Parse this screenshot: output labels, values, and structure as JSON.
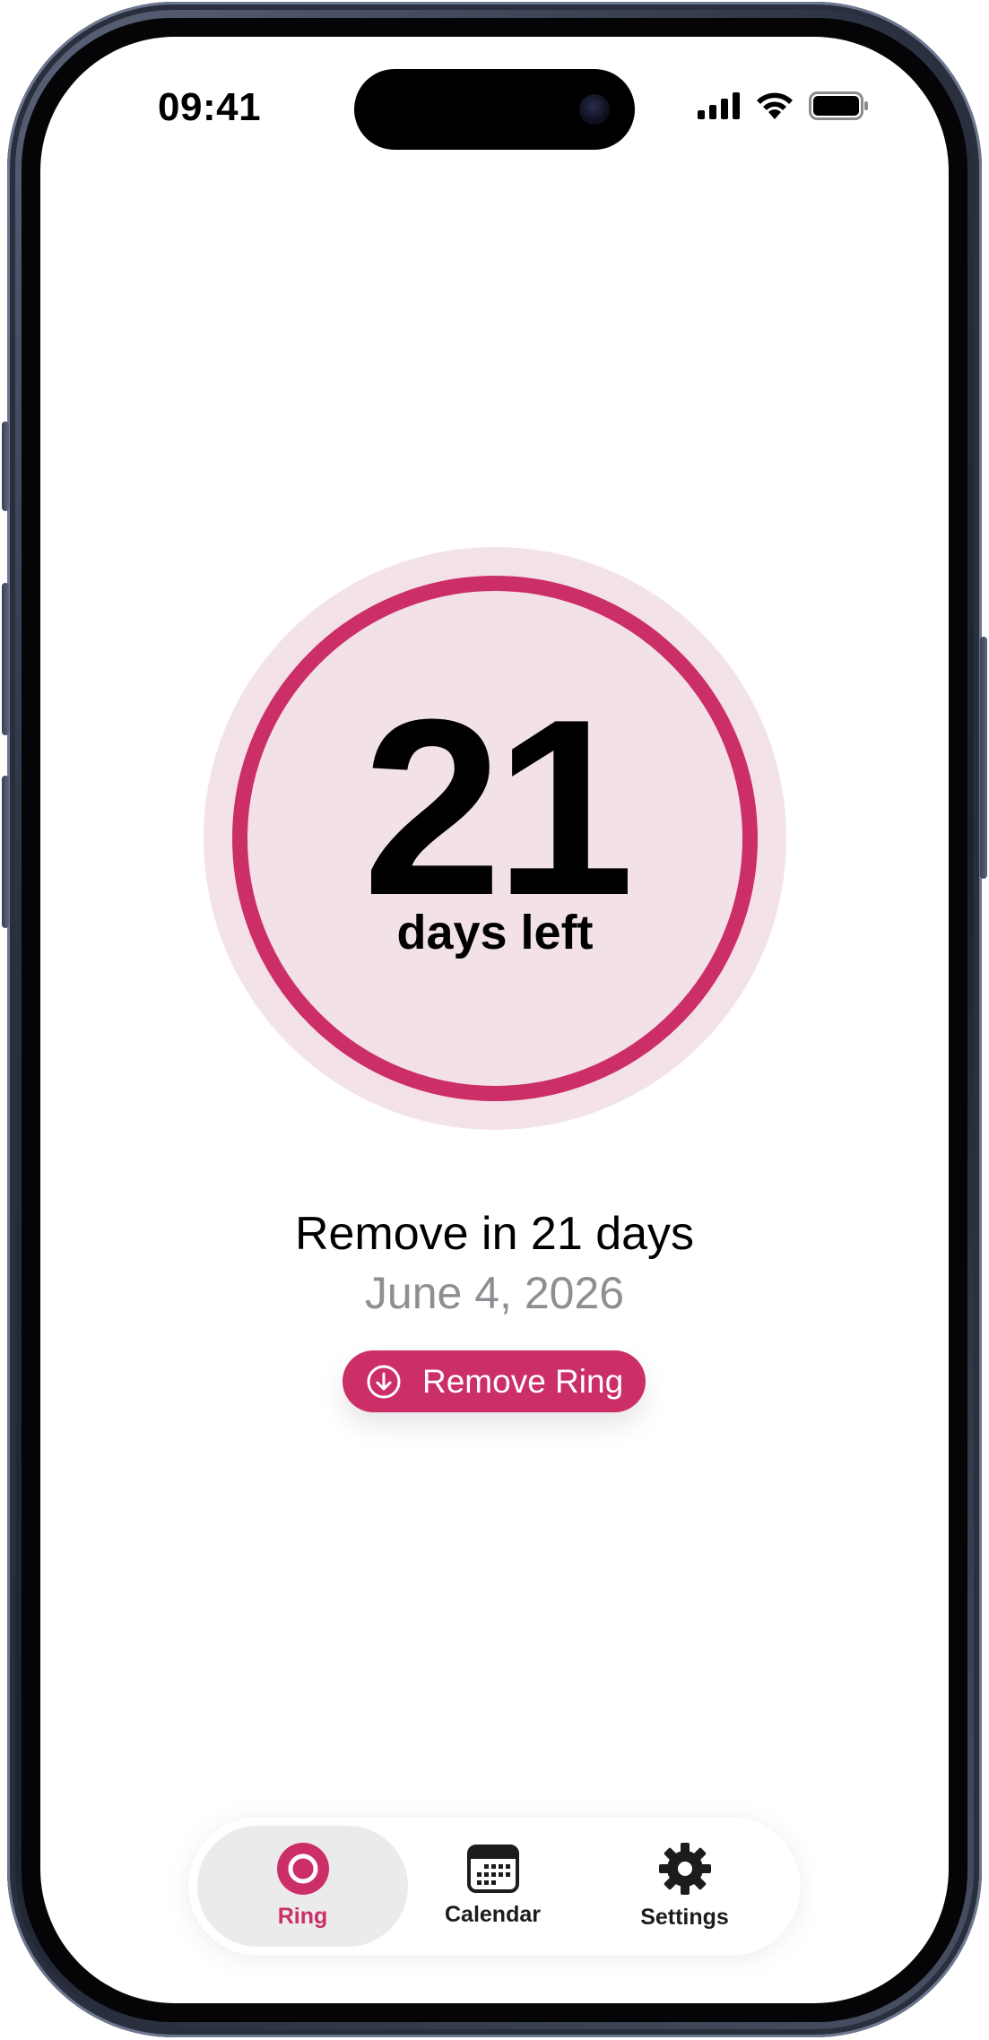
{
  "status_bar": {
    "time": "09:41"
  },
  "ring": {
    "days_number": "21",
    "days_label": "days left",
    "accent_color": "#cc2e68",
    "fill_color": "#f2e1e7"
  },
  "removal": {
    "title": "Remove in 21 days",
    "date": "June 4, 2026",
    "button_label": "Remove Ring",
    "button_icon": "arrow-down-circle-icon"
  },
  "tab_bar": {
    "tabs": [
      {
        "label": "Ring",
        "icon": "ring-icon",
        "active": true
      },
      {
        "label": "Calendar",
        "icon": "calendar-icon",
        "active": false
      },
      {
        "label": "Settings",
        "icon": "gear-icon",
        "active": false
      }
    ],
    "active_color": "#cc2e68",
    "inactive_color": "#1c1c1e"
  }
}
